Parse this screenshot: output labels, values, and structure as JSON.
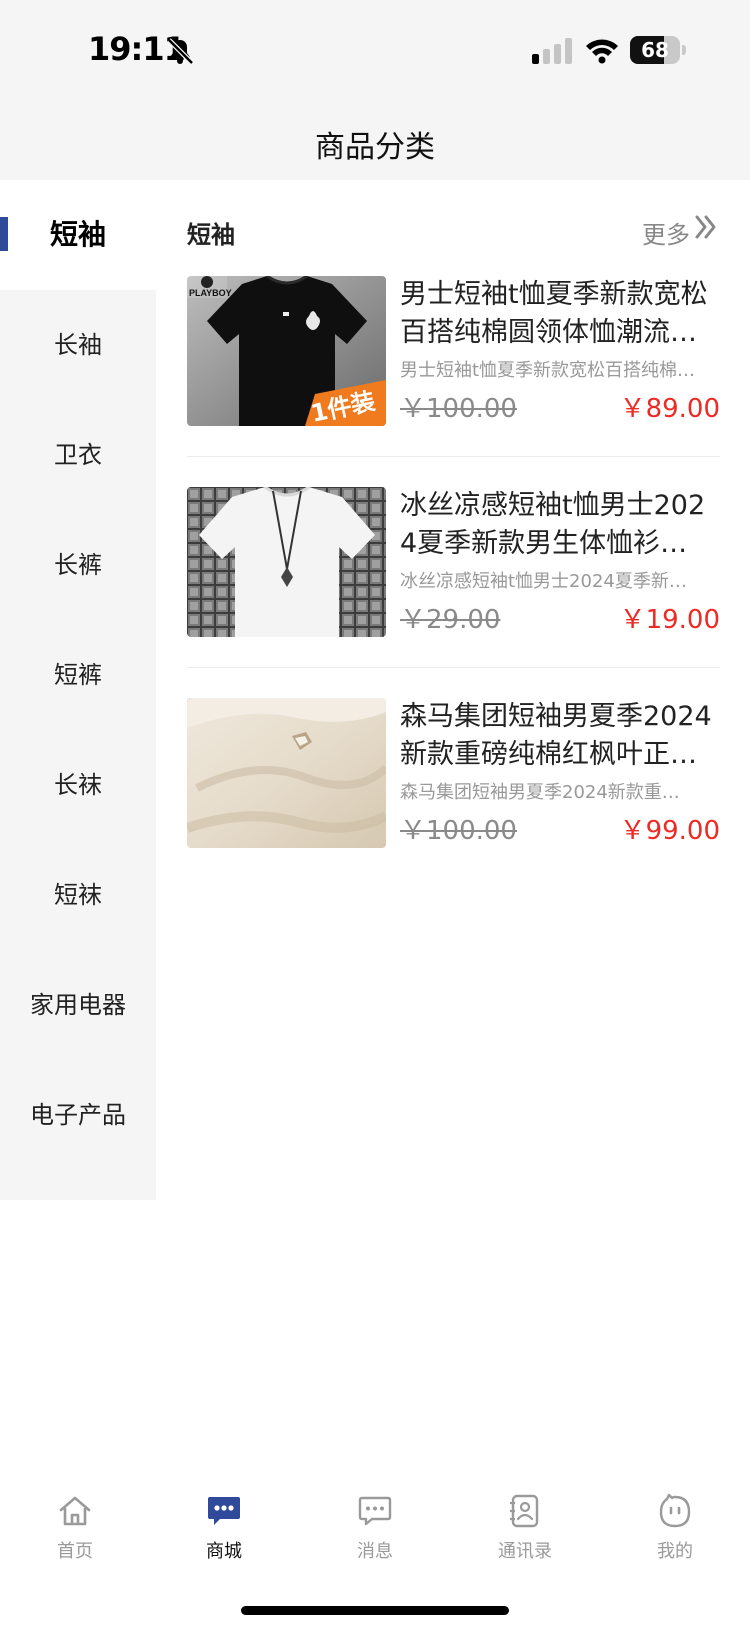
{
  "status_bar": {
    "time": "19:11",
    "battery": "68",
    "battery_level": 0.68
  },
  "header": {
    "title": "商品分类"
  },
  "sidebar": {
    "items": [
      {
        "label": "短袖",
        "active": true
      },
      {
        "label": "长袖"
      },
      {
        "label": "卫衣"
      },
      {
        "label": "长裤"
      },
      {
        "label": "短裤"
      },
      {
        "label": "长袜"
      },
      {
        "label": "短袜"
      },
      {
        "label": "家用电器"
      },
      {
        "label": "电子产品"
      }
    ]
  },
  "section": {
    "title": "短袖",
    "more_label": "更多"
  },
  "products": [
    {
      "title": "男士短袖t恤夏季新款宽松百搭纯棉圆领体恤潮流…",
      "subtitle": "男士短袖t恤夏季新款宽松百搭纯棉…",
      "old_price": "￥100.00",
      "price": "￥89.00",
      "image_text": {
        "brand": "PLAYBOY",
        "badge": "1件装"
      }
    },
    {
      "title": "冰丝凉感短袖t恤男士2024夏季新款男生体恤衫…",
      "subtitle": " 冰丝凉感短袖t恤男士2024夏季新…",
      "old_price": "￥29.00",
      "price": "￥19.00"
    },
    {
      "title": "森马集团短袖男夏季2024新款重磅纯棉红枫叶正…",
      "subtitle": " 森马集团短袖男夏季2024新款重…",
      "old_price": "￥100.00",
      "price": "￥99.00"
    }
  ],
  "tabbar": {
    "items": [
      {
        "label": "首页",
        "icon": "home-icon"
      },
      {
        "label": "商城",
        "icon": "chat-bubble-icon",
        "active": true
      },
      {
        "label": "消息",
        "icon": "message-icon"
      },
      {
        "label": "通讯录",
        "icon": "contacts-icon"
      },
      {
        "label": "我的",
        "icon": "profile-face-icon"
      }
    ]
  },
  "colors": {
    "accent": "#2f4a9a",
    "price_red": "#ee2a24",
    "sidebar_bg": "#f5f5f5"
  }
}
